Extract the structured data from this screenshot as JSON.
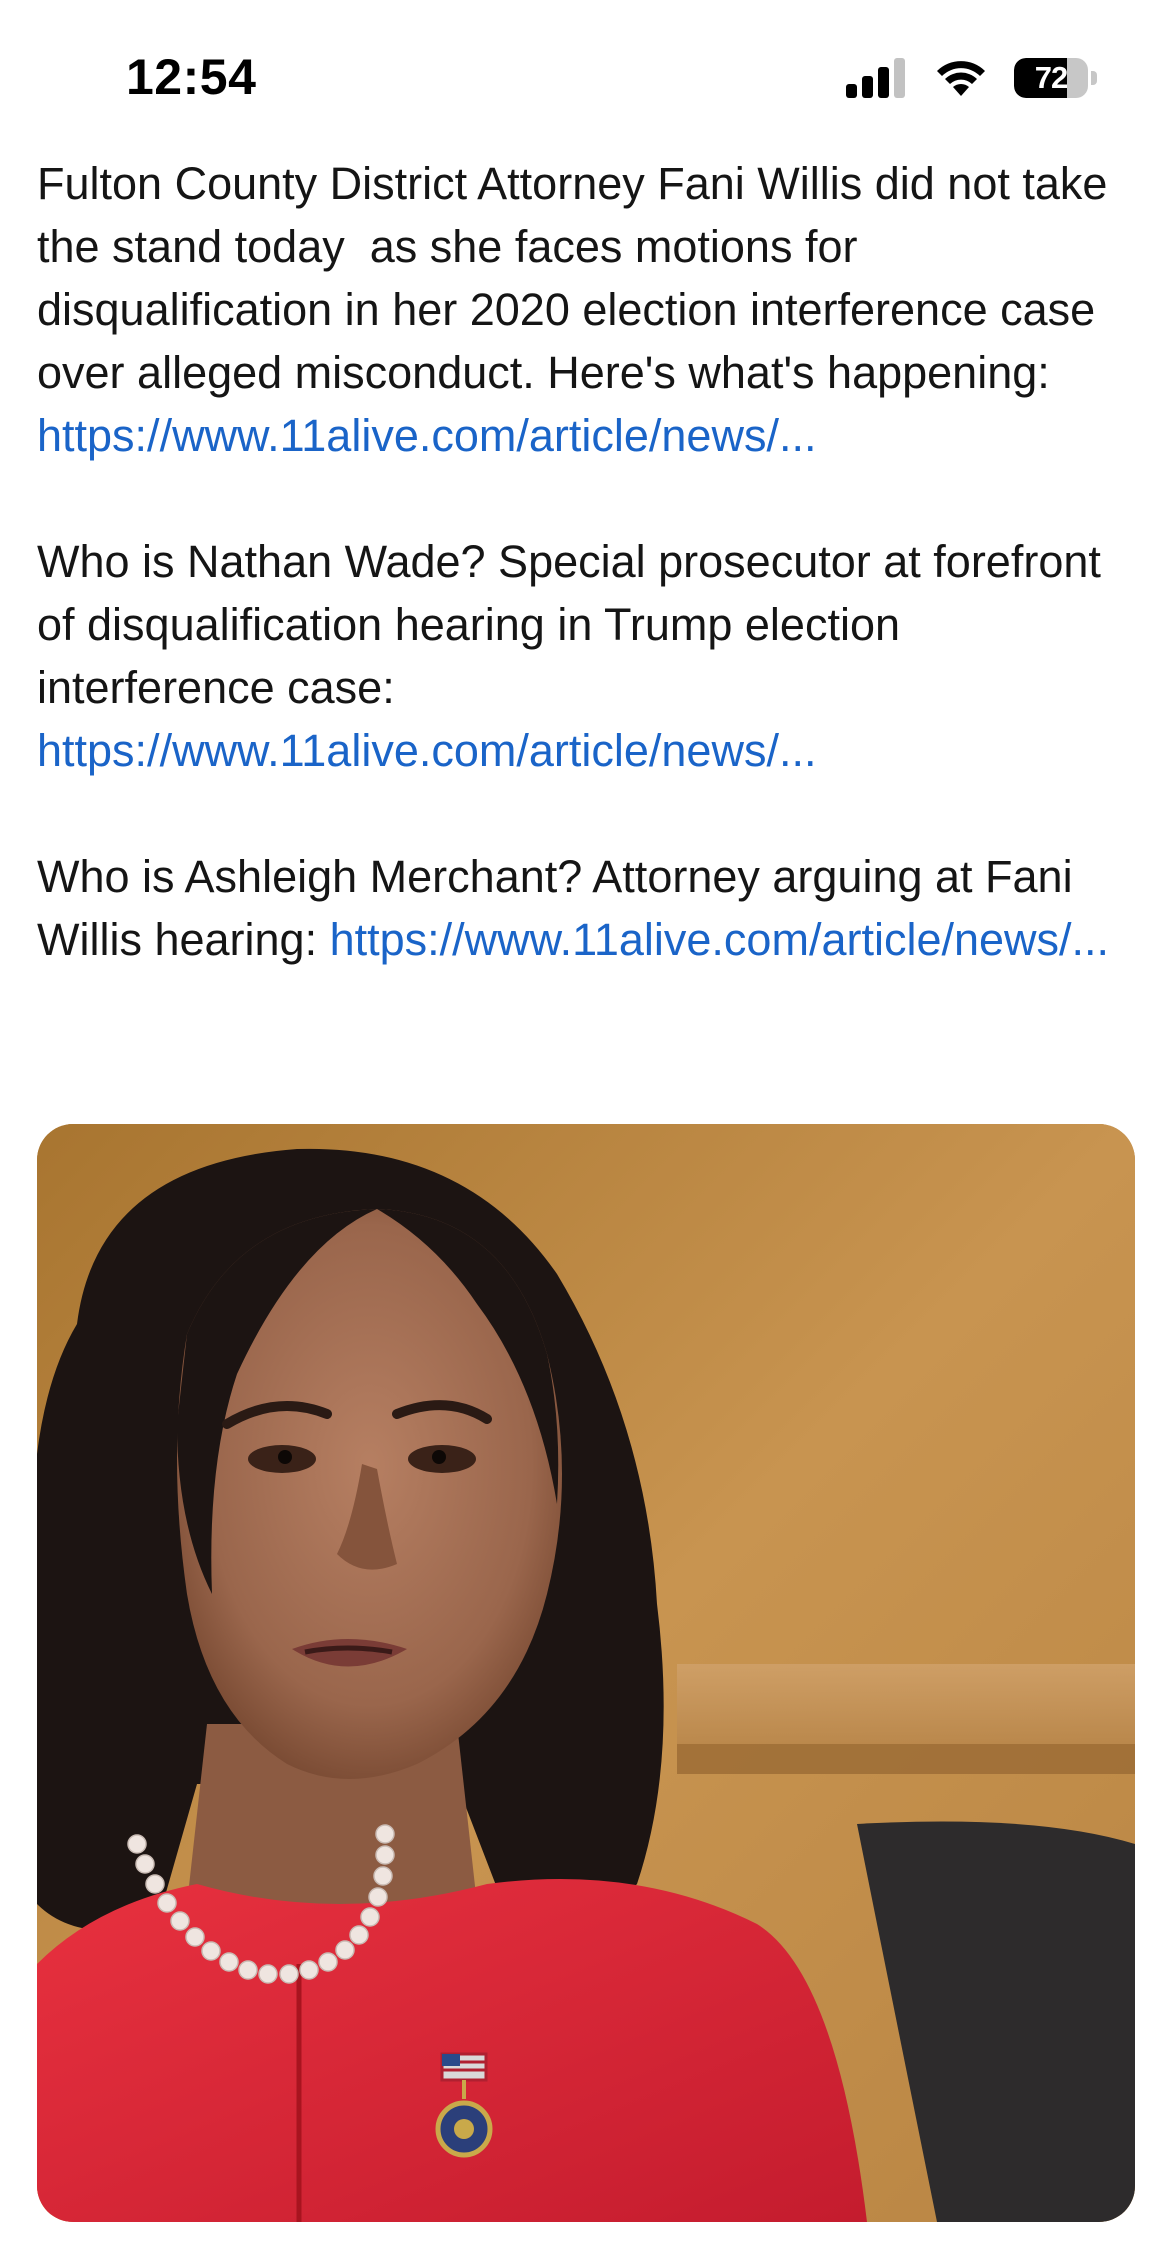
{
  "status_bar": {
    "time": "12:54",
    "battery_level": "72",
    "battery_fraction": 0.72,
    "icons": [
      "cellular-signal-icon",
      "wifi-icon",
      "battery-icon"
    ]
  },
  "post": {
    "paragraphs": [
      {
        "text": "Fulton County District Attorney Fani Willis did not take the stand today  as she faces motions for disqualification in her 2020 election interference case over alleged misconduct. Here's what's happening: ",
        "link": "https://www.11alive.com/article/news/..."
      },
      {
        "text": "Who is Nathan Wade? Special prosecutor at forefront of disqualification hearing in Trump election interference case: ",
        "link": "https://www.11alive.com/article/news/..."
      },
      {
        "text": "Who is Ashleigh Merchant? Attorney arguing at Fani Willis hearing: ",
        "link": "https://www.11alive.com/article/news/..."
      }
    ]
  },
  "photo": {
    "subject": "woman-in-red-dress-with-pearl-necklace-in-courtroom"
  },
  "colors": {
    "link": "#1a64c8",
    "text": "#151515",
    "background": "#ffffff",
    "dress": "#e0283c",
    "wood_panel": "#b98440"
  }
}
